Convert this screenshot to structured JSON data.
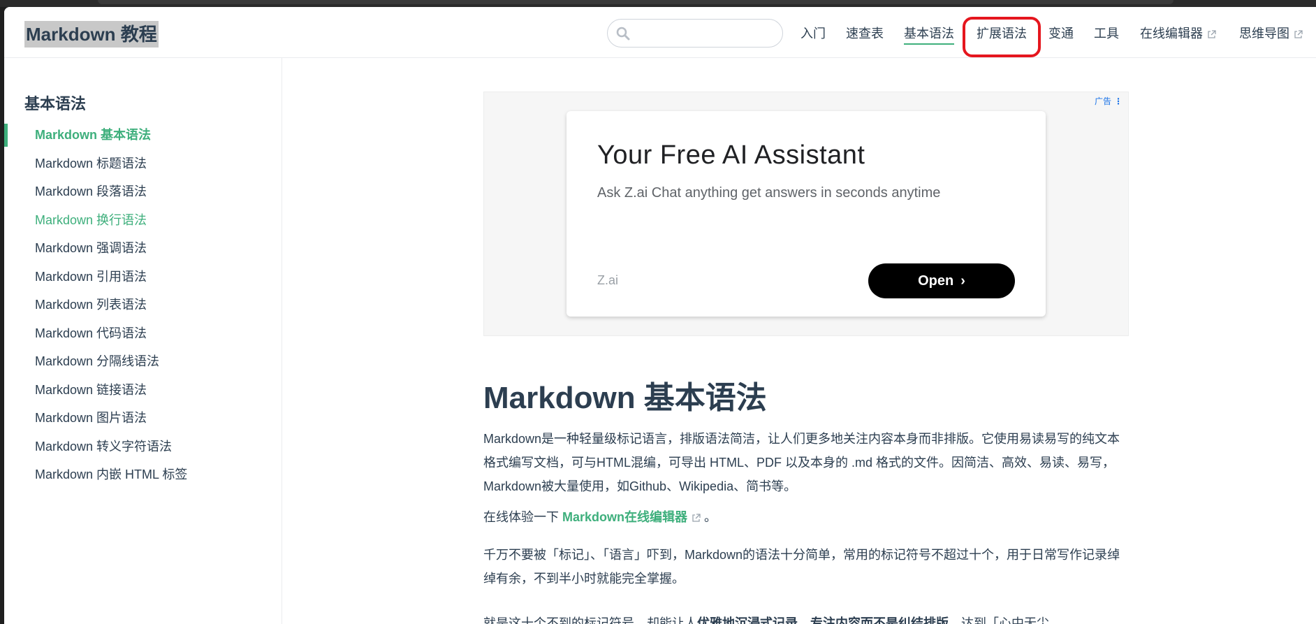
{
  "site_title": "Markdown 教程",
  "search": {
    "placeholder": "",
    "value": ""
  },
  "nav": [
    {
      "label": "入门",
      "external": false
    },
    {
      "label": "速查表",
      "external": false
    },
    {
      "label": "基本语法",
      "external": false,
      "active": true
    },
    {
      "label": "扩展语法",
      "external": false,
      "highlighted": true
    },
    {
      "label": "变通",
      "external": false
    },
    {
      "label": "工具",
      "external": false
    },
    {
      "label": "在线编辑器",
      "external": true
    },
    {
      "label": "思维导图",
      "external": true
    }
  ],
  "sidebar": {
    "heading": "基本语法",
    "items": [
      {
        "label": "Markdown 基本语法",
        "state": "active"
      },
      {
        "label": "Markdown 标题语法",
        "state": ""
      },
      {
        "label": "Markdown 段落语法",
        "state": ""
      },
      {
        "label": "Markdown 换行语法",
        "state": "hover"
      },
      {
        "label": "Markdown 强调语法",
        "state": ""
      },
      {
        "label": "Markdown 引用语法",
        "state": ""
      },
      {
        "label": "Markdown 列表语法",
        "state": ""
      },
      {
        "label": "Markdown 代码语法",
        "state": ""
      },
      {
        "label": "Markdown 分隔线语法",
        "state": ""
      },
      {
        "label": "Markdown 链接语法",
        "state": ""
      },
      {
        "label": "Markdown 图片语法",
        "state": ""
      },
      {
        "label": "Markdown 转义字符语法",
        "state": ""
      },
      {
        "label": "Markdown 内嵌 HTML 标签",
        "state": ""
      }
    ]
  },
  "ad": {
    "badge": "广告",
    "title": "Your Free AI Assistant",
    "description": "Ask Z.ai Chat anything get answers in seconds anytime",
    "brand": "Z.ai",
    "button": "Open"
  },
  "article": {
    "title": "Markdown 基本语法",
    "p1": "Markdown是一种轻量级标记语言，排版语法简洁，让人们更多地关注内容本身而非排版。它使用易读易写的纯文本格式编写文档，可与HTML混编，可导出 HTML、PDF 以及本身的 .md 格式的文件。因简洁、高效、易读、易写，Markdown被大量使用，如Github、Wikipedia、简书等。",
    "p2_prefix": "在线体验一下 ",
    "p2_link": "Markdown在线编辑器",
    "p2_suffix": " 。",
    "p3": "千万不要被「标记」、「语言」吓到，Markdown的语法十分简单，常用的标记符号不超过十个，用于日常写作记录绰绰有余，不到半小时就能完全掌握。",
    "p4_prefix": "就是这十个不到的标记符号，却能让人",
    "p4_bold1": "优雅地沉浸式记录",
    "p4_mid": "，",
    "p4_bold2": "专注内容而不是纠结排版",
    "p4_suffix": "，达到「心中无尘，"
  },
  "colors": {
    "accent": "#3eaf7c",
    "text": "#2c3e50",
    "highlight_ring": "#e5161e"
  }
}
